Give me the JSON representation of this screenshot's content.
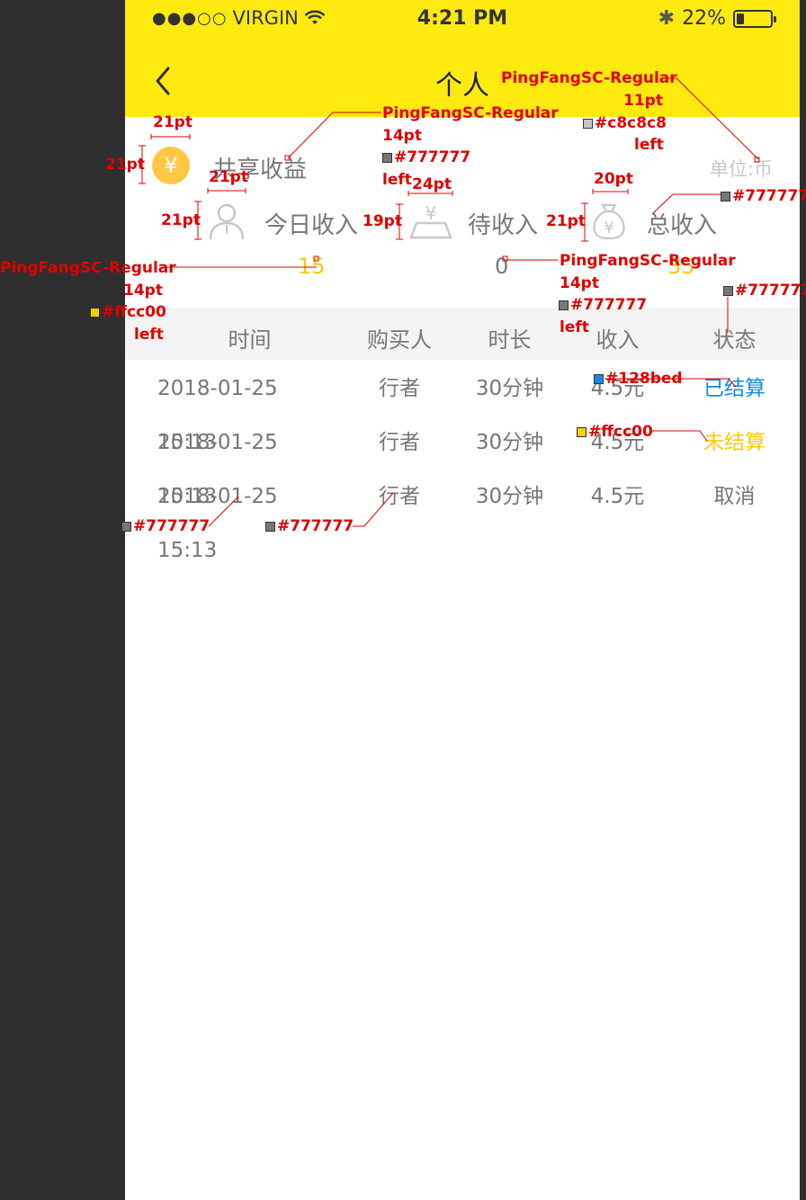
{
  "statusbar": {
    "signal": "●●●○○",
    "carrier": "VIRGIN",
    "time": "4:21 PM",
    "battery": "22%",
    "battery_level": 0.22
  },
  "nav": {
    "title": "个人"
  },
  "share": {
    "label": "共享收益",
    "unit": "单位:币"
  },
  "stats": [
    {
      "label": "今日收入",
      "value": "15",
      "value_color": "#ffcc00"
    },
    {
      "label": "待收入",
      "value": "0",
      "value_color": "#777777"
    },
    {
      "label": "总收入",
      "value": "35",
      "value_color": "#ffcc00"
    }
  ],
  "table": {
    "headers": [
      "时间",
      "购买人",
      "时长",
      "收入",
      "状态"
    ],
    "rows": [
      {
        "time": "2018-01-25 15:13",
        "buyer": "行者",
        "duration": "30分钟",
        "income": "4.5元",
        "status": "已结算",
        "status_color": "#128bed"
      },
      {
        "time": "2018-01-25 15:13",
        "buyer": "行者",
        "duration": "30分钟",
        "income": "4.5元",
        "status": "未结算",
        "status_color": "#ffcc00"
      },
      {
        "time": "2018-01-25 15:13",
        "buyer": "行者",
        "duration": "30分钟",
        "income": "4.5元",
        "status": "取消",
        "status_color": "#777777"
      }
    ]
  },
  "annotations": {
    "font_regular": "PingFangSC-Regular",
    "size_11": "11pt",
    "size_14": "14pt",
    "size_19": "19pt",
    "size_20": "20pt",
    "size_21": "21pt",
    "size_24": "24pt",
    "align_left": "left",
    "color_gray": "#777777",
    "color_light": "#c8c8c8",
    "color_yellow": "#ffcc00",
    "color_blue": "#128bed"
  },
  "colors": {
    "header_bg": "#ffea0f",
    "accent": "#ffcc00",
    "text": "#777777",
    "muted": "#c8c8c8",
    "link": "#128bed",
    "sidebar": "#2f2f2f"
  }
}
